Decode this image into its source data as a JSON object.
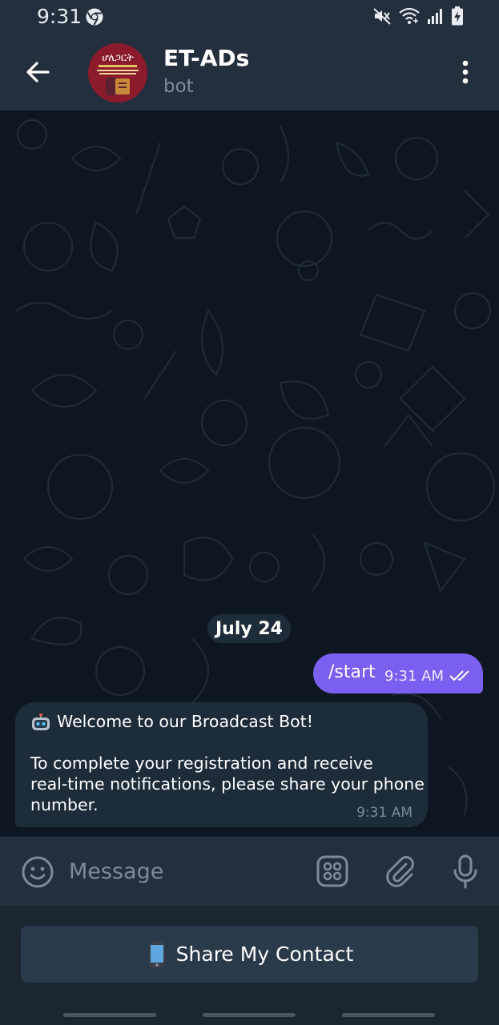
{
  "status_bar": {
    "time": "9:31",
    "icons": [
      "chrome-icon",
      "mute-icon",
      "wifi-icon",
      "signal-icon",
      "battery-charging-icon"
    ]
  },
  "header": {
    "back_icon": "arrow-left-icon",
    "title": "ET-ADs",
    "subtitle": "bot",
    "avatar_text": "ሆለጋርት",
    "more_icon": "more-vertical-icon"
  },
  "chat": {
    "date_label": "July 24",
    "messages": [
      {
        "direction": "outgoing",
        "text": "/start",
        "time": "9:31 AM",
        "status": "read"
      },
      {
        "direction": "incoming",
        "lines": [
          "Welcome to our Broadcast Bot!",
          "",
          "To complete your registration and receive",
          "real-time notifications, please share your phone",
          "number."
        ],
        "time": "9:31 AM"
      }
    ]
  },
  "composer": {
    "placeholder": "Message",
    "icons": [
      "emoji-icon",
      "bot-menu-icon",
      "attach-icon",
      "microphone-icon"
    ]
  },
  "keyboard": {
    "button_label": "Share My Contact",
    "button_icon": "mobile-phone-icon"
  },
  "colors": {
    "header_bg": "#242f3d",
    "chat_bg": "#0e1621",
    "outgoing_bubble": "#7a5ff0",
    "incoming_bubble": "#1e2c3a",
    "muted_text": "#7d8b99"
  }
}
